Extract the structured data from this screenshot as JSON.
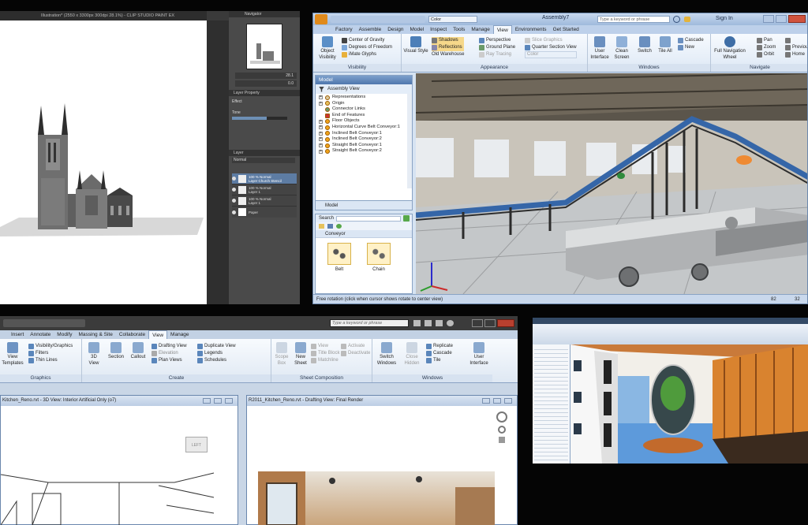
{
  "clip": {
    "title": "Illustration* (2550 x 3300px 300dpi 28.1%) - CLIP STUDIO PAINT EX",
    "navigator_tab": "Navigator",
    "zoom_value": "28.1",
    "rotate_value": "0.0",
    "layer_property_tab": "Layer Property",
    "effect_label": "Effect",
    "tone_label": "Tone",
    "layer_tab": "Layer",
    "blend_mode": "Normal",
    "layers": [
      {
        "name": "100 % Normal",
        "sub": "Layer Church Stencil"
      },
      {
        "name": "100 % Normal",
        "sub": "Layer 1"
      },
      {
        "name": "100 % Normal",
        "sub": "Layer 1"
      },
      {
        "name": "Paper",
        "sub": ""
      }
    ]
  },
  "inventor": {
    "title": "Assembly7",
    "search_placeholder": "Type a keyword or phrase",
    "sign_in": "Sign In",
    "color_field": "Color",
    "tabs": [
      "Factory",
      "Assemble",
      "Design",
      "Model",
      "Inspect",
      "Tools",
      "Manage",
      "View",
      "Environments",
      "Get Started"
    ],
    "active_tab": "View",
    "visibility": {
      "object_visibility": "Object Visibility",
      "items": [
        "Center of Gravity",
        "Degrees of Freedom",
        "iMate Glyphs"
      ],
      "group": "Visibility"
    },
    "appearance": {
      "visual_style": "Visual Style",
      "shadows": "Shadows",
      "reflections": "Reflections",
      "perspective": "Perspective",
      "ground_plane": "Ground Plane",
      "ray_tracing": "Ray Tracing",
      "slice_graphics": "Slice Graphics",
      "quarter_section": "Quarter Section View",
      "environment": "Old Warehouse",
      "color": "Color",
      "group": "Appearance"
    },
    "windows": {
      "user_interface": "User Interface",
      "clean_screen": "Clean Screen",
      "switch": "Switch",
      "tile_all": "Tile All",
      "cascade": "Cascade",
      "new": "New",
      "group": "Windows"
    },
    "navigate": {
      "full_nav_wheel": "Full Navigation Wheel",
      "pan": "Pan",
      "zoom": "Zoom",
      "orbit": "Orbit",
      "prev": "Previous",
      "home": "Home",
      "group": "Navigate"
    },
    "model_panel": {
      "title": "Model",
      "view": "Assembly View",
      "tree": [
        "Representations",
        "Origin",
        "Connector Links",
        "End of Features",
        "Floor Objects",
        "Horizontal Curve Belt Conveyor:1",
        "Inclined Belt Conveyor:1",
        "Inclined Belt Conveyor:2",
        "Straight Belt Conveyor:1",
        "Straight Belt Conveyor:2"
      ],
      "bottom_tab": "Model"
    },
    "search_panel": {
      "search_label": "Search",
      "category": "Conveyor",
      "items": [
        "Belt",
        "Chain"
      ]
    },
    "status": "Free rotation (click when cursor shows rotate to center view)",
    "status_num1": "82",
    "status_num2": "32"
  },
  "revit": {
    "search_placeholder": "Type a keyword or phrase",
    "tabs": [
      "Insert",
      "Annotate",
      "Modify",
      "Massing & Site",
      "Collaborate",
      "View",
      "Manage"
    ],
    "active_tab": "View",
    "graphics": {
      "view_templates": "View Templates",
      "visibility": "Visibility/Graphics",
      "filters": "Filters",
      "thin_lines": "Thin Lines",
      "group": "Graphics"
    },
    "create": {
      "view_3d": "3D View",
      "section": "Section",
      "callout": "Callout",
      "drafting_view": "Drafting View",
      "elevation": "Elevation",
      "plan_views": "Plan Views",
      "duplicate_view": "Duplicate View",
      "legends": "Legends",
      "schedules": "Schedules",
      "group": "Create"
    },
    "sheet": {
      "scope_box": "Scope Box",
      "new_sheet": "New Sheet",
      "view": "View",
      "title_block": "Title Block",
      "matchline": "Matchline",
      "activate": "Activate",
      "deactivate": "Deactivate",
      "group": "Sheet Composition"
    },
    "windows": {
      "switch_windows": "Switch Windows",
      "close_hidden": "Close Hidden",
      "replicate": "Replicate",
      "cascade": "Cascade",
      "tile": "Tile",
      "user_interface": "User Interface",
      "group": "Windows"
    },
    "view1_title": "Kitchen_Reno.rvt - 3D View: Interior Artificial Only (o7)",
    "view2_title": "R2011_Kitchen_Reno.rvt - Drafting View: Final Render",
    "viewcube_label": "LEFT"
  }
}
